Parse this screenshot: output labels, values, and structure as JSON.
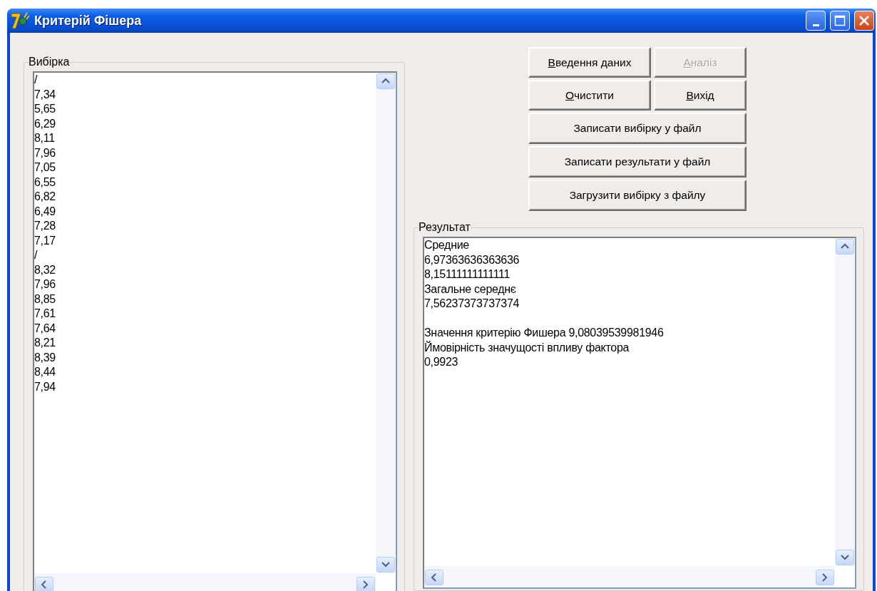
{
  "window": {
    "title": "Критерій Фішера"
  },
  "sample_group": {
    "label": "Вибірка",
    "lines": [
      "/",
      "7,34",
      "5,65",
      "6,29",
      "8,11",
      "7,96",
      "7,05",
      "6,55",
      "6,82",
      "6,49",
      "7,28",
      "7,17",
      "/",
      "8,32",
      "7,96",
      "8,85",
      "7,61",
      "7,64",
      "8,21",
      "8,39",
      "8,44",
      "7,94"
    ]
  },
  "buttons": [
    {
      "label": "Введення даних",
      "underline_first": true,
      "disabled": false,
      "kind": "half"
    },
    {
      "label": "Аналіз",
      "underline_first": true,
      "disabled": true,
      "kind": "half"
    },
    {
      "label": "Очистити",
      "underline_first": true,
      "disabled": false,
      "kind": "half"
    },
    {
      "label": "Вихід",
      "underline_first": true,
      "disabled": false,
      "kind": "half"
    },
    {
      "label": "Записати вибірку у файл",
      "underline_first": false,
      "disabled": false,
      "kind": "wide"
    },
    {
      "label": "Записати результати у файл",
      "underline_first": false,
      "disabled": false,
      "kind": "wide"
    },
    {
      "label": "Загрузити вибірку з файлу",
      "underline_first": false,
      "disabled": false,
      "kind": "wide"
    }
  ],
  "result_group": {
    "label": "Результат",
    "lines": [
      {
        "kind": "text",
        "text": "Средние"
      },
      {
        "kind": "text",
        "text": "6,97363636363636"
      },
      {
        "kind": "text",
        "text": "8,15111111111111"
      },
      {
        "kind": "text",
        "text": "Загальне середнє"
      },
      {
        "kind": "text",
        "text": "7,56237373737374"
      },
      {
        "kind": "gap"
      },
      {
        "kind": "text",
        "text": "Значення критерію Фишера 9,08039539981946"
      },
      {
        "kind": "text",
        "text": "Ймовірність значущості впливу фактора"
      },
      {
        "kind": "text",
        "text": "0,9923"
      }
    ]
  }
}
